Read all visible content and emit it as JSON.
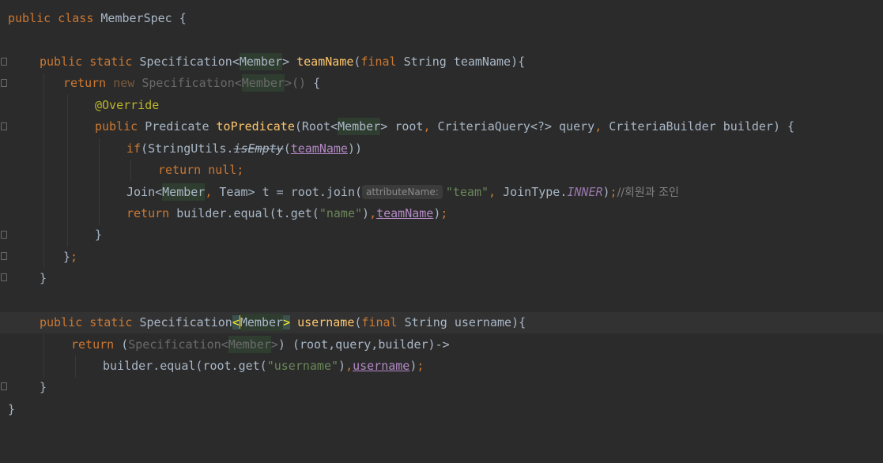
{
  "editor": {
    "lines": [
      {
        "id": "l1"
      },
      {
        "id": "l2"
      }
    ],
    "tokens": {
      "public": "public",
      "class": "class",
      "static": "static",
      "return": "return",
      "new": "new",
      "final": "final",
      "if": "if",
      "null": "null",
      "class_name": "MemberSpec",
      "open_brace": "{",
      "close_brace": "}",
      "specification": "Specification",
      "member": "Member",
      "string": "String",
      "team_name_fn": "teamName",
      "team_name_param": "teamName",
      "override": "@Override",
      "predicate": "Predicate",
      "to_predicate": "toPredicate",
      "root_type": "Root",
      "root": "root",
      "criteria_query": "CriteriaQuery<?>",
      "query": "query",
      "criteria_builder": "CriteriaBuilder",
      "builder": "builder",
      "string_utils": "StringUtils.",
      "is_empty": "isEmpty",
      "join": "Join",
      "team": "Team",
      "t": "t",
      "root_join": "root.join(",
      "hint_attribute": "attributeName:",
      "str_team": "\"team\"",
      "join_type": "JoinType.",
      "inner": "INNER",
      "comment_join": "//회원과 조인",
      "builder_equal": "builder.equal(",
      "t_get": "t.get(",
      "str_name": "\"name\"",
      "username_fn": "username",
      "username_param": "username",
      "query_lambda": "(root,query,builder)->",
      "root_get": "root.get(",
      "str_username": "\"username\""
    }
  }
}
